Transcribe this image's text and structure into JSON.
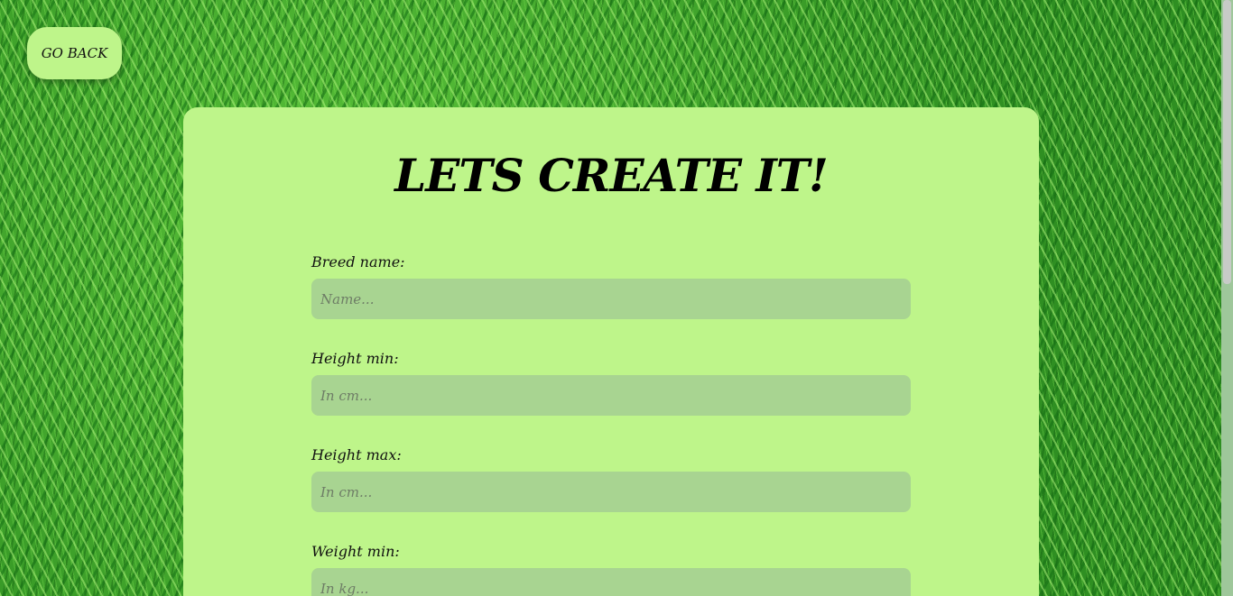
{
  "nav": {
    "go_back_label": "GO BACK"
  },
  "form": {
    "title": "LETS CREATE IT!",
    "fields": [
      {
        "label": "Breed name:",
        "placeholder": "Name..."
      },
      {
        "label": "Height min:",
        "placeholder": "In cm..."
      },
      {
        "label": "Height max:",
        "placeholder": "In cm..."
      },
      {
        "label": "Weight min:",
        "placeholder": "In kg..."
      }
    ]
  },
  "colors": {
    "card_background": "#bef58a",
    "input_background": "#a8d491",
    "text": "#000000"
  }
}
